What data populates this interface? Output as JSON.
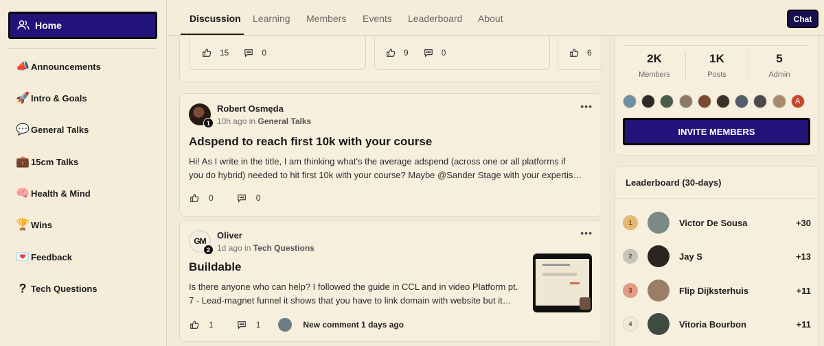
{
  "sidebar": {
    "home_label": "Home",
    "items": [
      {
        "icon": "megaphone-icon",
        "emoji": "📣",
        "label": "Announcements"
      },
      {
        "icon": "rocket-icon",
        "emoji": "🚀",
        "label": "Intro & Goals"
      },
      {
        "icon": "speech-bubble-icon",
        "emoji": "💬",
        "label": "General Talks"
      },
      {
        "icon": "briefcase-icon",
        "emoji": "💼",
        "label": "15cm Talks"
      },
      {
        "icon": "brain-icon",
        "emoji": "🧠",
        "label": "Health & Mind"
      },
      {
        "icon": "trophy-icon",
        "emoji": "🏆",
        "label": "Wins"
      },
      {
        "icon": "love-letter-icon",
        "emoji": "💌",
        "label": "Feedback"
      },
      {
        "icon": "question-mark-icon",
        "emoji": "?",
        "label": "Tech Questions"
      }
    ]
  },
  "tabs": [
    "Discussion",
    "Learning",
    "Members",
    "Events",
    "Leaderboard",
    "About"
  ],
  "chat_label": "Chat",
  "top_strip": {
    "cards": [
      {
        "likes": "15",
        "comments": "0"
      },
      {
        "likes": "9",
        "comments": "0"
      },
      {
        "likes": "6"
      }
    ]
  },
  "posts": [
    {
      "author": "Robert Osmęda",
      "badge": "1",
      "time": "10h ago in ",
      "category": "General Talks",
      "title": "Adspend to reach first 10k with your course",
      "body_line1": "Hi! As I write in the title, I am thinking what's the average adspend (across one or all platforms if",
      "body_line2": "you do hybrid) needed to hit first 10k with your course? Maybe @Sander Stage with your expertis…",
      "likes": "0",
      "comments": "0"
    },
    {
      "author": "Oliver",
      "badge": "2",
      "avatar_text": "GM",
      "time": "1d ago in ",
      "category": "Tech Questions",
      "title": "Buildable",
      "body_line1": "Is there anyone who can help? I followed the guide in CCL and in video Platform pt.",
      "body_line2": "7 - Lead-magnet funnel it shows that you have to link domain with website but it…",
      "likes": "1",
      "comments": "1",
      "new_comment": "New comment 1 days ago"
    }
  ],
  "community_stats": {
    "members_count": "2K",
    "members_label": "Members",
    "posts_count": "1K",
    "posts_label": "Posts",
    "admin_count": "5",
    "admin_label": "Admin",
    "last_avatar_letter": "A",
    "invite_label": "INVITE MEMBERS"
  },
  "leaderboard": {
    "title": "Leaderboard (30-days)",
    "rows": [
      {
        "rank": "1",
        "name": "Victor De Sousa",
        "points": "+30"
      },
      {
        "rank": "2",
        "name": "Jay S",
        "points": "+13"
      },
      {
        "rank": "3",
        "name": "Flip Dijksterhuis",
        "points": "+11"
      },
      {
        "rank": "4",
        "name": "Vitoria Bourbon",
        "points": "+11"
      }
    ]
  },
  "colors": {
    "background": "#f2ead8",
    "primary_button": "#22137a",
    "card": "#f7efde"
  }
}
